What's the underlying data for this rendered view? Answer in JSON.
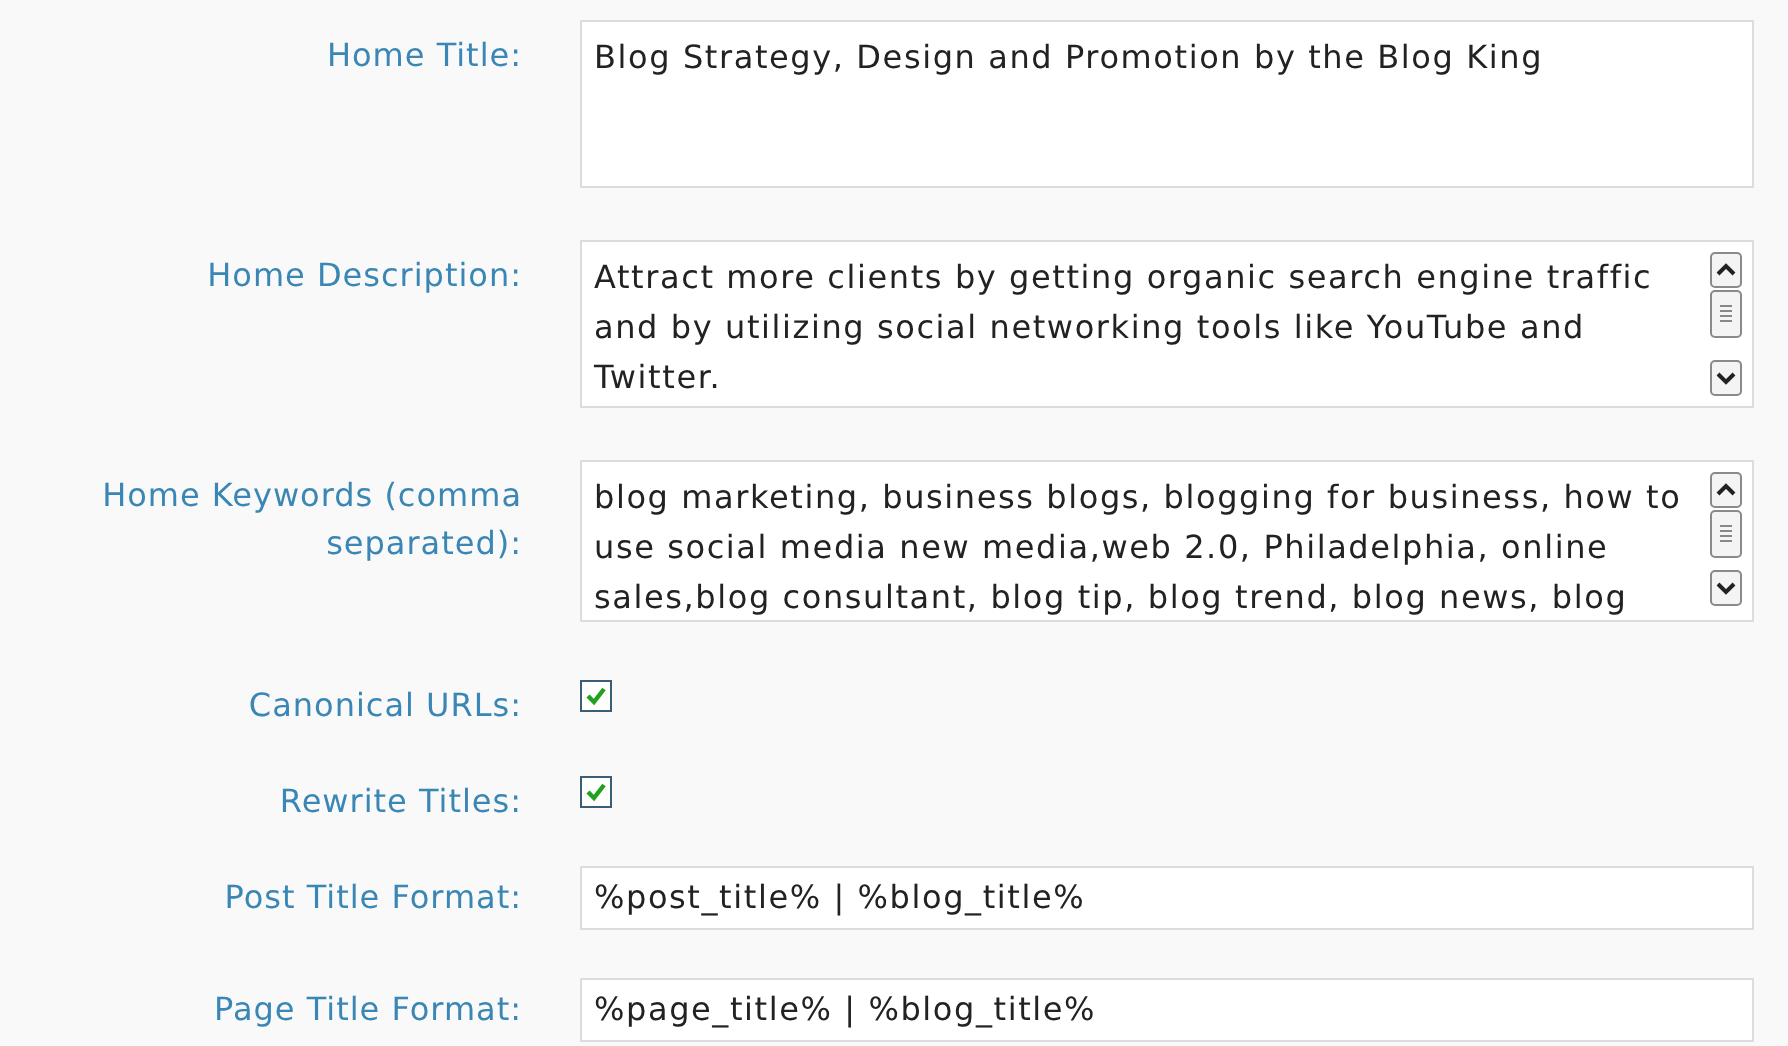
{
  "fields": [
    {
      "kind": "textarea",
      "label": "Home Title:",
      "scrollable": false,
      "lines": [
        "Blog Strategy, Design and Promotion by the Blog King"
      ]
    },
    {
      "kind": "textarea",
      "label": "Home Description:",
      "scrollable": true,
      "lines": [
        "Attract more clients by getting organic search engine traffic",
        "and by utilizing social networking tools like YouTube and",
        "Twitter."
      ]
    },
    {
      "kind": "textarea",
      "label": "Home Keywords (comma separated):",
      "scrollable": true,
      "lines": [
        "blog marketing, business blogs, blogging for business, how to",
        "use social media new media,web 2.0, Philadelphia, online",
        "sales,blog consultant, blog tip, blog trend, blog news, blog"
      ]
    },
    {
      "kind": "checkbox",
      "label": "Canonical URLs:",
      "checked": true
    },
    {
      "kind": "checkbox",
      "label": "Rewrite Titles:",
      "checked": true
    },
    {
      "kind": "text",
      "label": "Post Title Format:",
      "value": "%post_title% | %blog_title%"
    },
    {
      "kind": "text",
      "label": "Page Title Format:",
      "value": "%page_title% | %blog_title%"
    }
  ]
}
